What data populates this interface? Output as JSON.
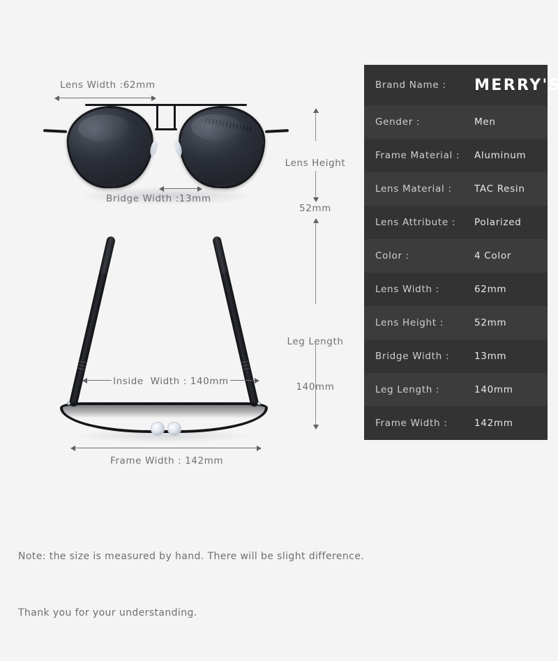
{
  "background_color": "#f4f4f4",
  "diagram": {
    "front_view": {
      "name": "aviator-sunglasses-front-view",
      "lens_color": "#2b2f38",
      "frame_color": "#17181c"
    },
    "top_view": {
      "name": "aviator-sunglasses-top-view",
      "frame_color": "#141519"
    },
    "annotations": [
      {
        "id": "lens-width",
        "text": "Lens Width :62mm"
      },
      {
        "id": "lens-height",
        "line1": "Lens Height",
        "line2": "52mm"
      },
      {
        "id": "bridge-width",
        "text": "Bridge Width :13mm"
      },
      {
        "id": "leg-length",
        "line1": "Leg Length",
        "line2": "140mm"
      },
      {
        "id": "inside-width",
        "text": "Inside  Width : 140mm"
      },
      {
        "id": "frame-width",
        "text": "Frame Width : 142mm"
      }
    ]
  },
  "spec_panel": {
    "background_color": "#333333",
    "row_alt_color": "#3c3c3c",
    "brand": {
      "key": "Brand Name :",
      "value": "MERRY'S"
    },
    "rows": [
      {
        "key": "Gender :",
        "value": "Men"
      },
      {
        "key": "Frame Material :",
        "value": "Aluminum"
      },
      {
        "key": "Lens Material :",
        "value": "TAC Resin"
      },
      {
        "key": "Lens Attribute :",
        "value": "Polarized"
      },
      {
        "key": "Color :",
        "value": "4 Color"
      },
      {
        "key": "Lens Width :",
        "value": "62mm"
      },
      {
        "key": "Lens Height :",
        "value": "52mm"
      },
      {
        "key": "Bridge Width :",
        "value": "13mm"
      },
      {
        "key": "Leg Length :",
        "value": "140mm"
      },
      {
        "key": "Frame Width :",
        "value": "142mm"
      }
    ]
  },
  "note": {
    "line1": "Note: the size is measured by hand. There will be slight difference.",
    "line2": "Thank you for your understanding."
  }
}
